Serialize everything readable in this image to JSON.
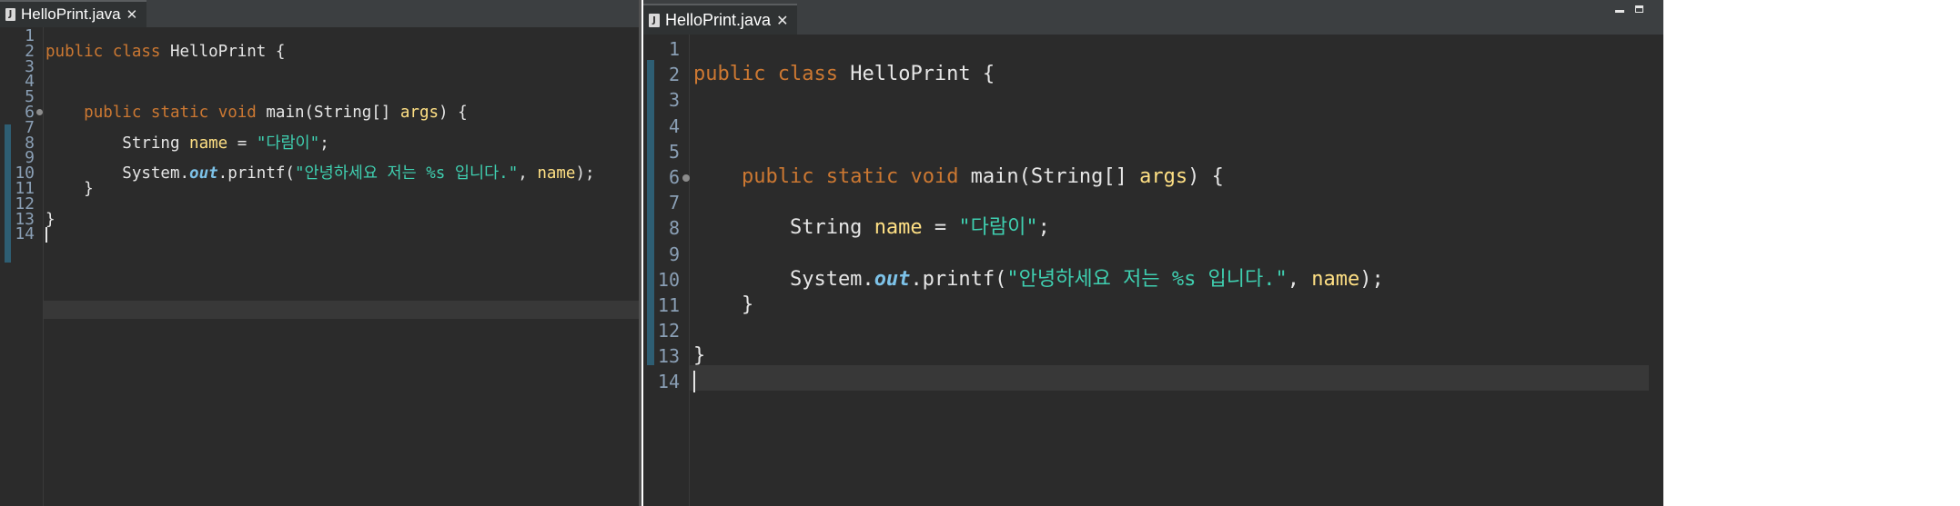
{
  "left_editor": {
    "tab_label": "HelloPrint.java",
    "file_icon": "J",
    "close_glyph": "✕",
    "lines": [
      {
        "num": "1",
        "tokens": []
      },
      {
        "num": "2",
        "tokens": [
          {
            "t": "public",
            "c": "kw"
          },
          {
            "t": " "
          },
          {
            "t": "class",
            "c": "kw"
          },
          {
            "t": " HelloPrint {"
          }
        ]
      },
      {
        "num": "3",
        "tokens": []
      },
      {
        "num": "4",
        "tokens": []
      },
      {
        "num": "5",
        "tokens": []
      },
      {
        "num": "6",
        "tokens": [
          {
            "t": "    "
          },
          {
            "t": "public",
            "c": "kw"
          },
          {
            "t": " "
          },
          {
            "t": "static",
            "c": "kw"
          },
          {
            "t": " "
          },
          {
            "t": "void",
            "c": "kw"
          },
          {
            "t": " main(String[] "
          },
          {
            "t": "args",
            "c": "var"
          },
          {
            "t": ") {"
          }
        ]
      },
      {
        "num": "7",
        "tokens": []
      },
      {
        "num": "8",
        "tokens": [
          {
            "t": "        String "
          },
          {
            "t": "name",
            "c": "var"
          },
          {
            "t": " = "
          },
          {
            "t": "\"다람이\"",
            "c": "str"
          },
          {
            "t": ";"
          }
        ]
      },
      {
        "num": "9",
        "tokens": []
      },
      {
        "num": "10",
        "tokens": [
          {
            "t": "        System."
          },
          {
            "t": "out",
            "c": "fld"
          },
          {
            "t": ".printf("
          },
          {
            "t": "\"안녕하세요 저는 %s 입니다.\"",
            "c": "str"
          },
          {
            "t": ", "
          },
          {
            "t": "name",
            "c": "var"
          },
          {
            "t": ");"
          }
        ]
      },
      {
        "num": "11",
        "tokens": [
          {
            "t": "    }"
          }
        ]
      },
      {
        "num": "12",
        "tokens": []
      },
      {
        "num": "13",
        "tokens": [
          {
            "t": "}"
          }
        ]
      },
      {
        "num": "14",
        "tokens": []
      }
    ]
  },
  "right_editor": {
    "tab_label": "HelloPrint.java",
    "file_icon": "J",
    "close_glyph": "✕",
    "lines": [
      {
        "num": "1",
        "tokens": []
      },
      {
        "num": "2",
        "tokens": [
          {
            "t": "public",
            "c": "kw"
          },
          {
            "t": " "
          },
          {
            "t": "class",
            "c": "kw"
          },
          {
            "t": " HelloPrint {"
          }
        ]
      },
      {
        "num": "3",
        "tokens": []
      },
      {
        "num": "4",
        "tokens": []
      },
      {
        "num": "5",
        "tokens": []
      },
      {
        "num": "6",
        "tokens": [
          {
            "t": "    "
          },
          {
            "t": "public",
            "c": "kw"
          },
          {
            "t": " "
          },
          {
            "t": "static",
            "c": "kw"
          },
          {
            "t": " "
          },
          {
            "t": "void",
            "c": "kw"
          },
          {
            "t": " main(String[] "
          },
          {
            "t": "args",
            "c": "var"
          },
          {
            "t": ") {"
          }
        ]
      },
      {
        "num": "7",
        "tokens": []
      },
      {
        "num": "8",
        "tokens": [
          {
            "t": "        String "
          },
          {
            "t": "name",
            "c": "var"
          },
          {
            "t": " = "
          },
          {
            "t": "\"다람이\"",
            "c": "str"
          },
          {
            "t": ";"
          }
        ]
      },
      {
        "num": "9",
        "tokens": []
      },
      {
        "num": "10",
        "tokens": [
          {
            "t": "        System."
          },
          {
            "t": "out",
            "c": "fld"
          },
          {
            "t": ".printf("
          },
          {
            "t": "\"안녕하세요 저는 %s 입니다.\"",
            "c": "str"
          },
          {
            "t": ", "
          },
          {
            "t": "name",
            "c": "var"
          },
          {
            "t": ");"
          }
        ]
      },
      {
        "num": "11",
        "tokens": [
          {
            "t": "    }"
          }
        ]
      },
      {
        "num": "12",
        "tokens": []
      },
      {
        "num": "13",
        "tokens": [
          {
            "t": "}"
          }
        ]
      },
      {
        "num": "14",
        "tokens": []
      }
    ]
  },
  "colors": {
    "background": "#2b2b2b",
    "keyword": "#cc7832",
    "variable": "#ffe084",
    "string": "#3fcfb0",
    "static_field": "#7dc2e8",
    "line_number": "#8a9fb5",
    "current_line": "#383838",
    "change_marker": "#2e5e73"
  },
  "icons": {
    "file": "java-file-icon",
    "close": "close-icon",
    "minimize": "minimize-icon",
    "maximize": "maximize-icon",
    "breakpoint": "override-marker-icon"
  }
}
